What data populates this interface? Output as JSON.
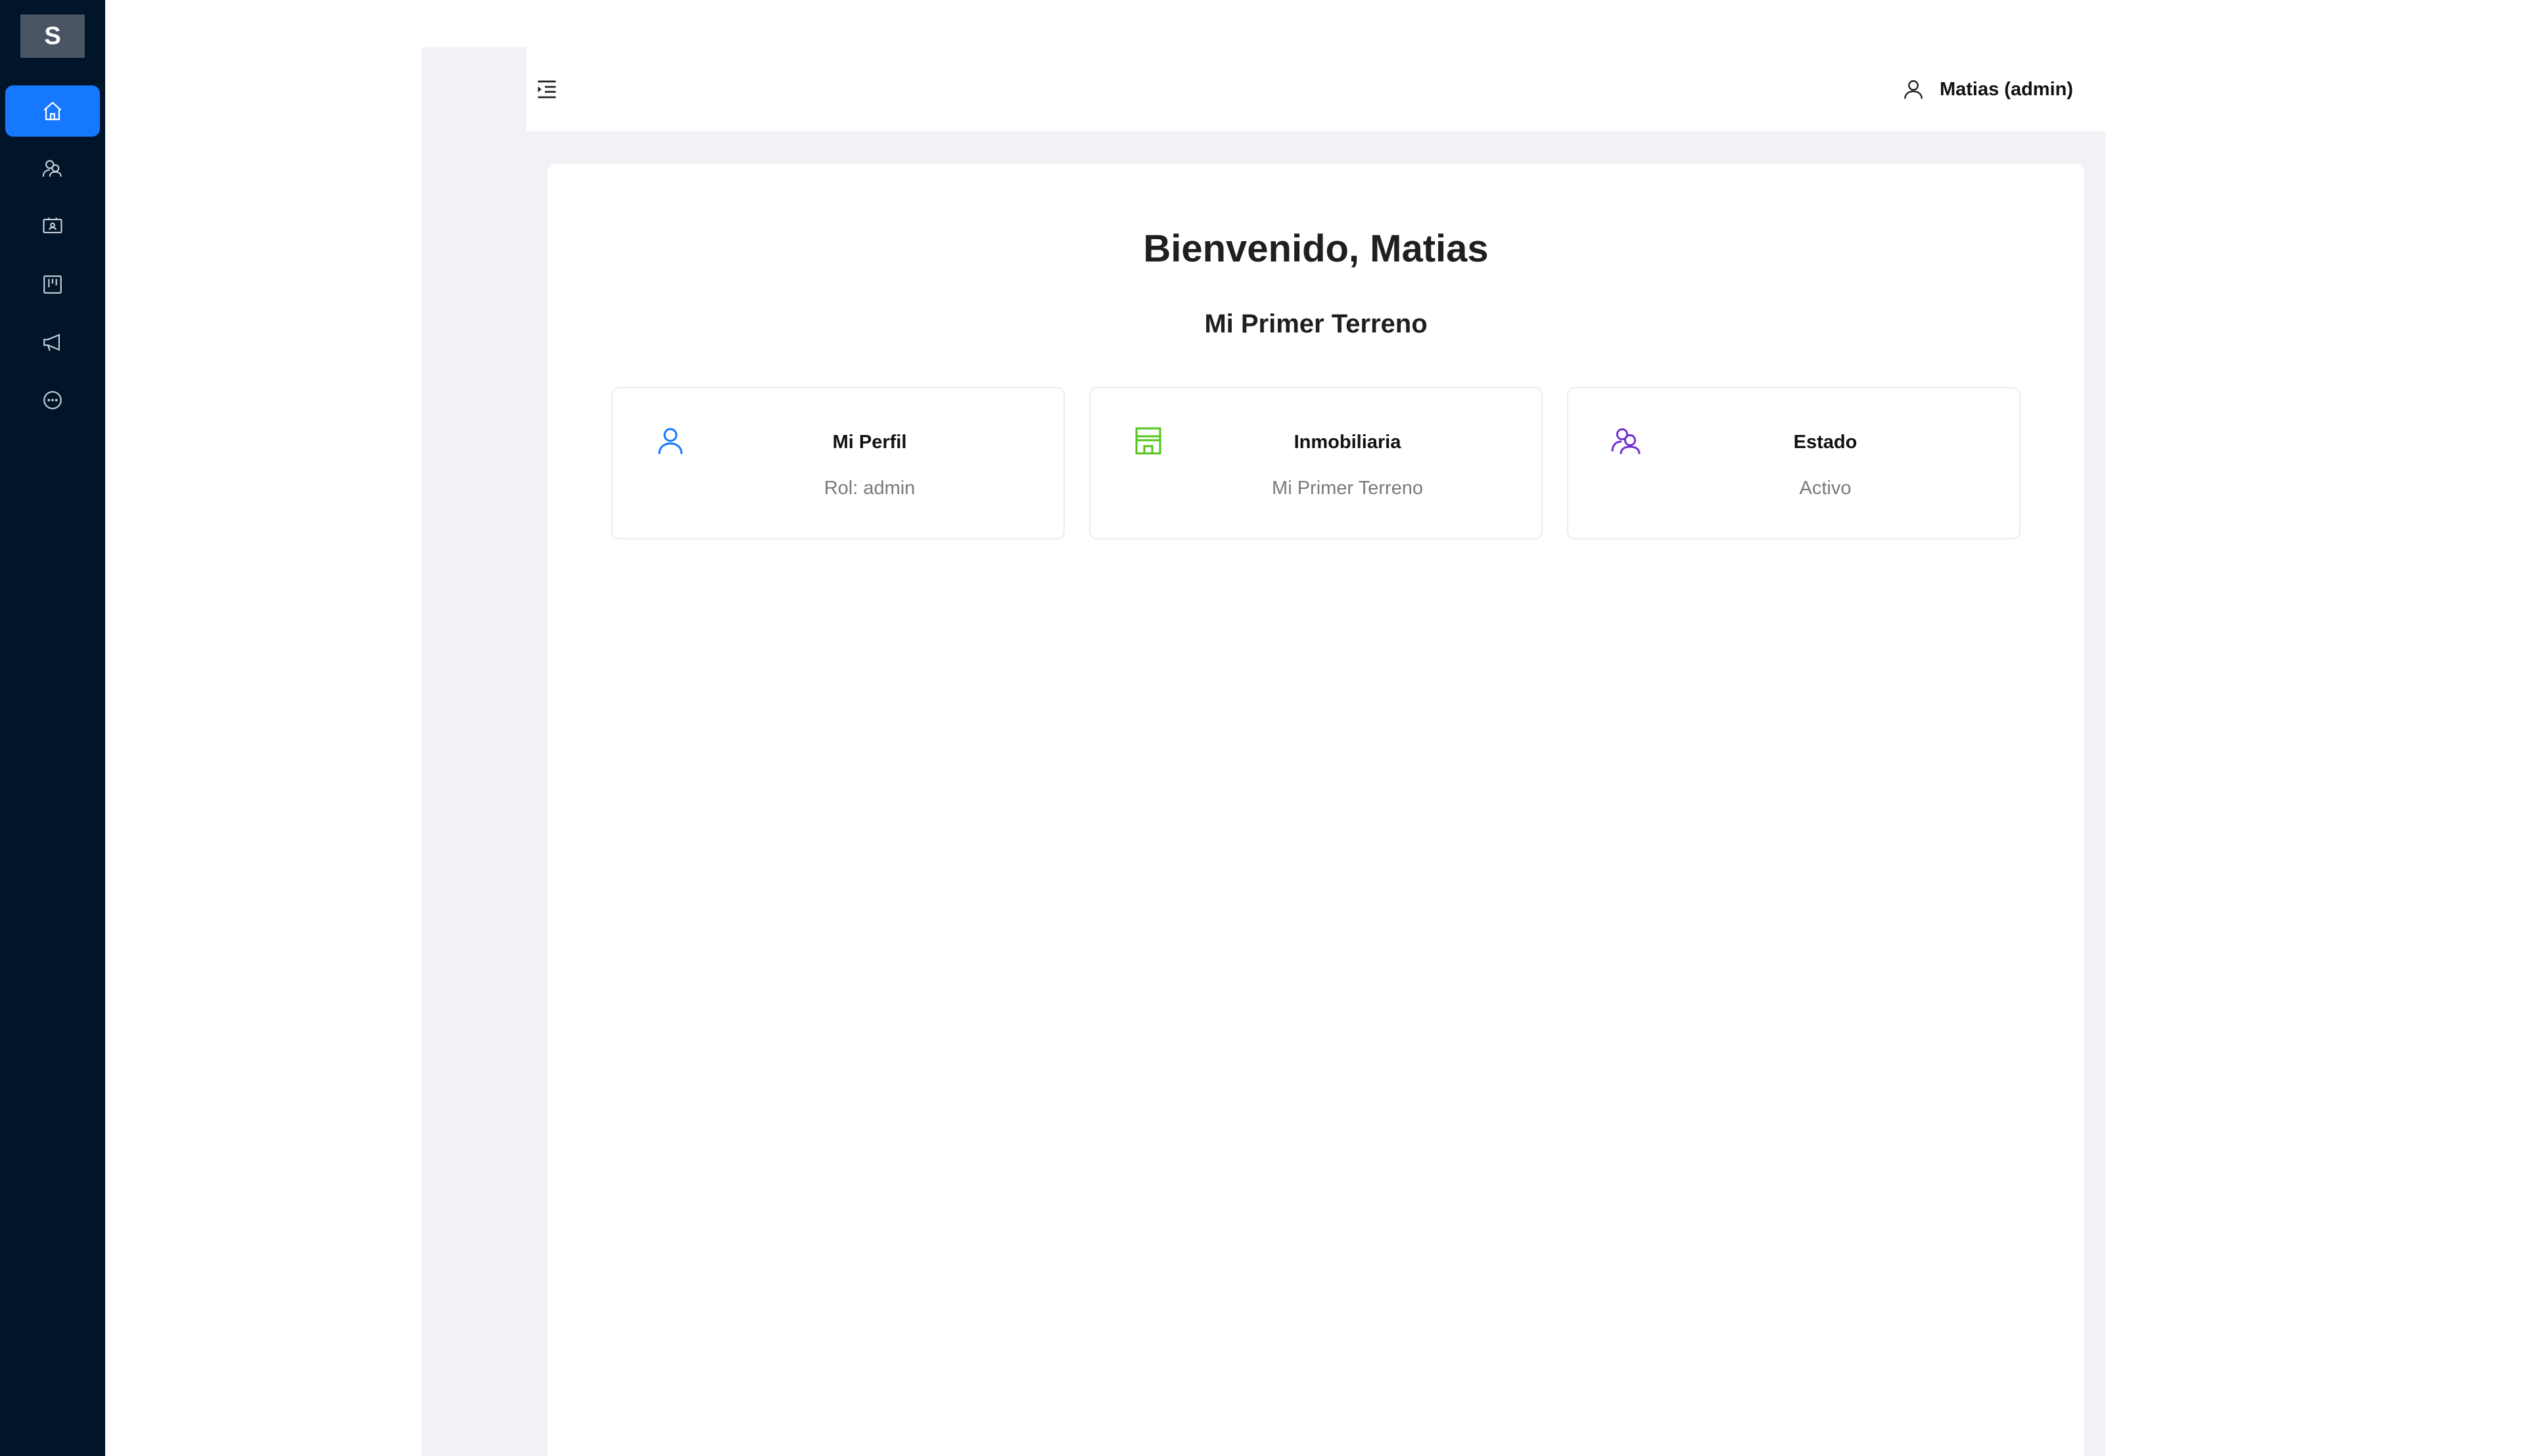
{
  "sidebar": {
    "logo": "S",
    "items": [
      {
        "icon": "home-icon",
        "active": true
      },
      {
        "icon": "users-icon",
        "active": false
      },
      {
        "icon": "id-card-icon",
        "active": false
      },
      {
        "icon": "project-icon",
        "active": false
      },
      {
        "icon": "megaphone-icon",
        "active": false
      },
      {
        "icon": "chat-icon",
        "active": false
      }
    ]
  },
  "header": {
    "menu_icon": "menu-indent-icon",
    "user_icon": "user-icon",
    "user_label": "Matias (admin)"
  },
  "main": {
    "welcome": "Bienvenido, Matias",
    "subtitle": "Mi Primer Terreno",
    "cards": [
      {
        "icon": "user-icon",
        "title": "Mi Perfil",
        "value": "Rol: admin",
        "color": "#1677ff"
      },
      {
        "icon": "shop-icon",
        "title": "Inmobiliaria",
        "value": "Mi Primer Terreno",
        "color": "#52c41a"
      },
      {
        "icon": "team-icon",
        "title": "Estado",
        "value": "Activo",
        "color": "#722ed1"
      }
    ]
  },
  "colors": {
    "sidebar_bg": "#001529",
    "accent": "#1677ff",
    "layout_bg": "#f0f2f5"
  }
}
